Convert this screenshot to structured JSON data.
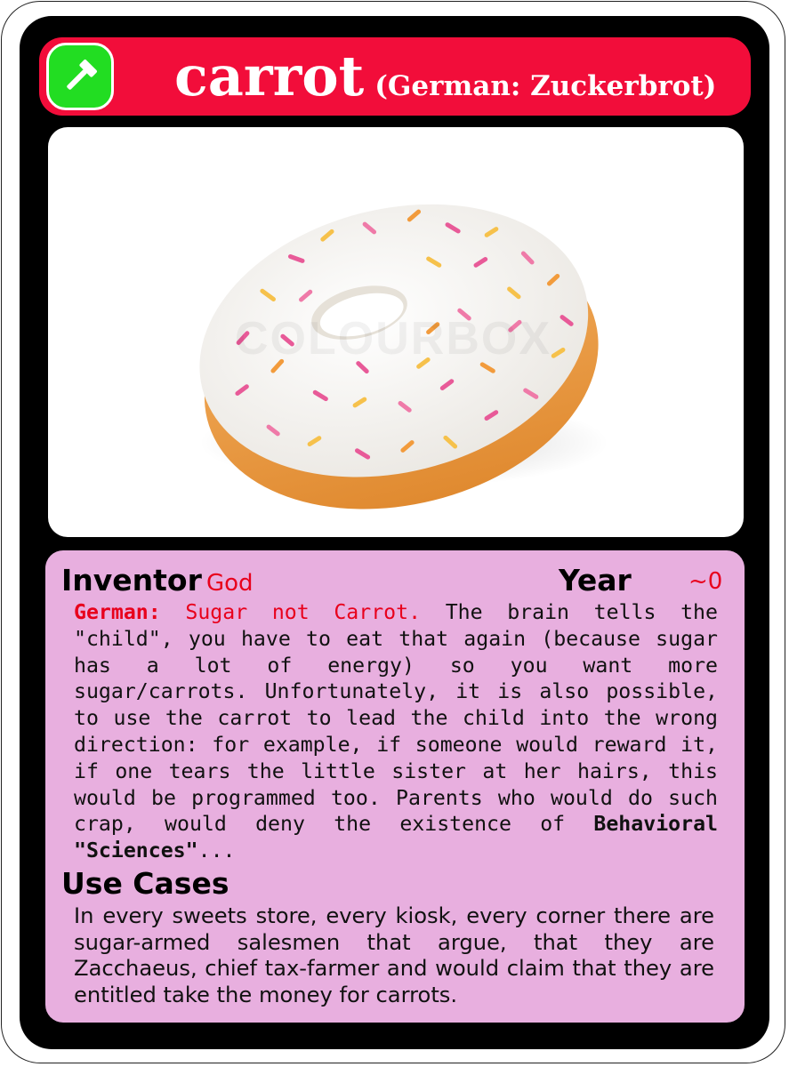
{
  "card": {
    "title": "carrot",
    "subtitle": "(German: Zuckerbrot)",
    "badge_icon": "hammer-icon",
    "image_alt": "white frosted donut with colorful sprinkles",
    "watermark": "COLOURBOX"
  },
  "stats": {
    "inventor_label": "Inventor",
    "inventor_value": "God",
    "year_label": "Year",
    "year_value": "~0"
  },
  "description": {
    "german_label": "German:",
    "german_value": "Sugar not Carrot.",
    "text_1": "The brain tells the \"child\", you have to eat that again (because sugar has a lot of energy) so you want more sugar/carrots. Unfortunately, it is also possible, to use the carrot to lead the child into the wrong direction: for example, if someone would reward it, if one tears the little sister at her hairs, this would be programmed too. Parents who would do such crap, would deny the existence of",
    "bold_term": "Behavioral \"Sciences\"",
    "text_2": "..."
  },
  "use_cases": {
    "heading": "Use Cases",
    "text": "In every sweets store, every kiosk, every corner there are sugar-armed salesmen that argue, that they are Zacchaeus, chief tax-farmer and would claim that they are entitled take the money for carrots."
  },
  "colors": {
    "title_bar": "#f20d3a",
    "badge": "#22dd22",
    "info_panel": "#e8afdf",
    "accent_red": "#e8001c"
  }
}
